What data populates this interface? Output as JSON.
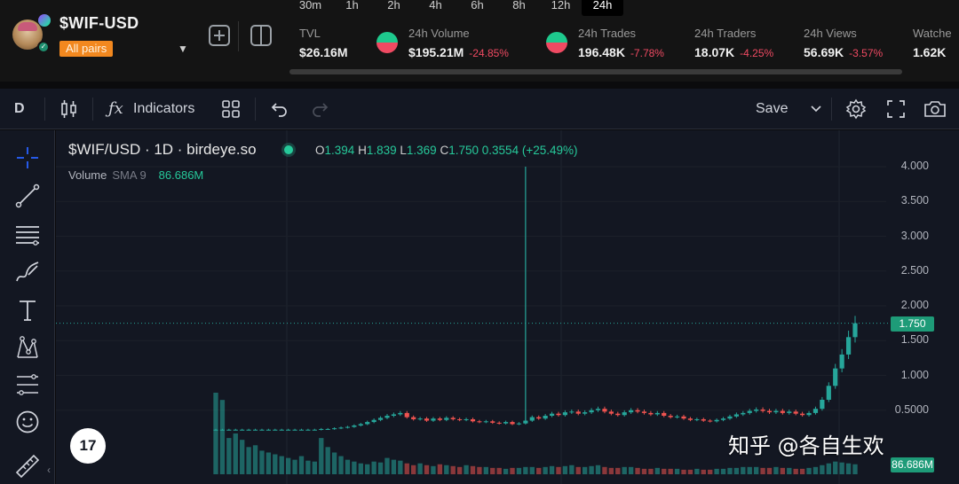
{
  "header": {
    "pair": "$WIF-USD",
    "all_pairs_label": "All pairs",
    "timeframes": [
      "30m",
      "1h",
      "2h",
      "4h",
      "6h",
      "8h",
      "12h",
      "24h"
    ],
    "active_timeframe": "24h",
    "stats": [
      {
        "label": "TVL",
        "value": "$26.16M",
        "change": ""
      },
      {
        "label": "24h Volume",
        "value": "$195.21M",
        "change": "-24.85%"
      },
      {
        "label": "24h Trades",
        "value": "196.48K",
        "change": "-7.78%"
      },
      {
        "label": "24h Traders",
        "value": "18.07K",
        "change": "-4.25%"
      },
      {
        "label": "24h Views",
        "value": "56.69K",
        "change": "-3.57%"
      },
      {
        "label": "Watche",
        "value": "1.62K",
        "change": ""
      }
    ],
    "colors": {
      "accent": "#f2881f",
      "up": "#1ec98d",
      "down": "#ef4a62"
    }
  },
  "toolbar": {
    "interval": "D",
    "indicators_label": "Indicators",
    "save_label": "Save",
    "icons": [
      "candles-icon",
      "fx-icon",
      "layout-grid-icon",
      "undo-icon",
      "redo-icon",
      "chevron-down-icon",
      "gear-icon",
      "fullscreen-icon",
      "camera-icon"
    ]
  },
  "left_tools": [
    "crosshair-icon",
    "trendline-icon",
    "fib-lines-icon",
    "brush-icon",
    "text-icon",
    "pattern-icon",
    "measure-lines-icon",
    "emoji-icon",
    "ruler-icon"
  ],
  "legend": {
    "title": "$WIF/USD · 1D · birdeye.so",
    "open_label": "O",
    "open": "1.394",
    "high_label": "H",
    "high": "1.839",
    "low_label": "L",
    "low": "1.369",
    "close_label": "C",
    "close": "1.750",
    "change": "0.3554",
    "change_pct": "(+25.49%)",
    "volume_label": "Volume",
    "sma_label": "SMA 9",
    "volume_value": "86.686M"
  },
  "logo_text": "17",
  "watermark": "知乎 @各自生欢",
  "price_tag": "1.750",
  "volume_tag": "86.686M",
  "chart_data": {
    "type": "candlestick",
    "y_ticks": [
      "4.000",
      "3.500",
      "3.000",
      "2.500",
      "2.000",
      "1.500",
      "1.000",
      "0.5000"
    ],
    "ylim": [
      0,
      4.0
    ],
    "current_price": 1.75,
    "series": [
      {
        "name": "Volume",
        "type": "bar"
      }
    ],
    "closes": [
      0.22,
      0.22,
      0.22,
      0.22,
      0.22,
      0.22,
      0.22,
      0.22,
      0.22,
      0.22,
      0.22,
      0.22,
      0.22,
      0.22,
      0.22,
      0.22,
      0.23,
      0.23,
      0.24,
      0.25,
      0.26,
      0.28,
      0.3,
      0.33,
      0.36,
      0.39,
      0.42,
      0.44,
      0.46,
      0.4,
      0.37,
      0.38,
      0.35,
      0.38,
      0.36,
      0.39,
      0.37,
      0.36,
      0.37,
      0.34,
      0.33,
      0.34,
      0.32,
      0.31,
      0.33,
      0.3,
      0.31,
      0.35,
      0.4,
      0.38,
      0.42,
      0.45,
      0.43,
      0.47,
      0.48,
      0.45,
      0.47,
      0.5,
      0.52,
      0.48,
      0.45,
      0.43,
      0.47,
      0.5,
      0.48,
      0.46,
      0.44,
      0.46,
      0.42,
      0.4,
      0.41,
      0.38,
      0.36,
      0.37,
      0.35,
      0.34,
      0.36,
      0.38,
      0.41,
      0.44,
      0.46,
      0.49,
      0.51,
      0.49,
      0.47,
      0.49,
      0.46,
      0.48,
      0.45,
      0.43,
      0.46,
      0.52,
      0.65,
      0.85,
      1.1,
      1.3,
      1.55,
      1.75
    ],
    "volumes": [
      90,
      82,
      40,
      45,
      38,
      30,
      32,
      26,
      24,
      22,
      20,
      18,
      16,
      20,
      15,
      14,
      40,
      30,
      24,
      20,
      16,
      14,
      12,
      11,
      14,
      13,
      18,
      16,
      15,
      12,
      10,
      12,
      10,
      9,
      11,
      10,
      9,
      8,
      10,
      9,
      8,
      8,
      7,
      7,
      6,
      7,
      7,
      8,
      8,
      7,
      8,
      9,
      8,
      9,
      10,
      8,
      8,
      9,
      10,
      8,
      7,
      7,
      8,
      8,
      7,
      6,
      6,
      7,
      6,
      6,
      6,
      5,
      5,
      6,
      5,
      5,
      6,
      6,
      7,
      7,
      8,
      8,
      8,
      7,
      7,
      8,
      7,
      7,
      6,
      6,
      7,
      8,
      10,
      12,
      14,
      13,
      12,
      11
    ]
  }
}
